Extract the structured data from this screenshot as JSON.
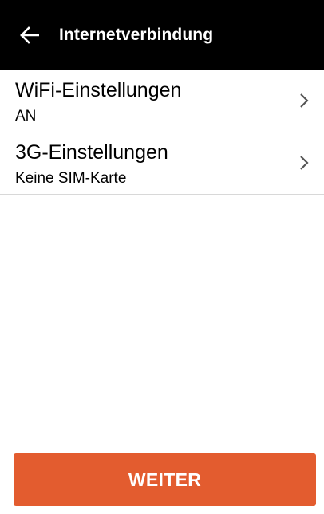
{
  "header": {
    "back_icon": "arrow-left-icon",
    "title": "Internetverbindung"
  },
  "settings": {
    "items": [
      {
        "title": "WiFi-Einstellungen",
        "subtitle": "AN",
        "icon": "chevron-right-icon"
      },
      {
        "title": "3G-Einstellungen",
        "subtitle": "Keine SIM-Karte",
        "icon": "chevron-right-icon"
      }
    ]
  },
  "footer": {
    "next_label": "WEITER"
  },
  "colors": {
    "app_bar": "#000000",
    "primary_button": "#e35c2f",
    "divider": "#d8d8d8"
  }
}
